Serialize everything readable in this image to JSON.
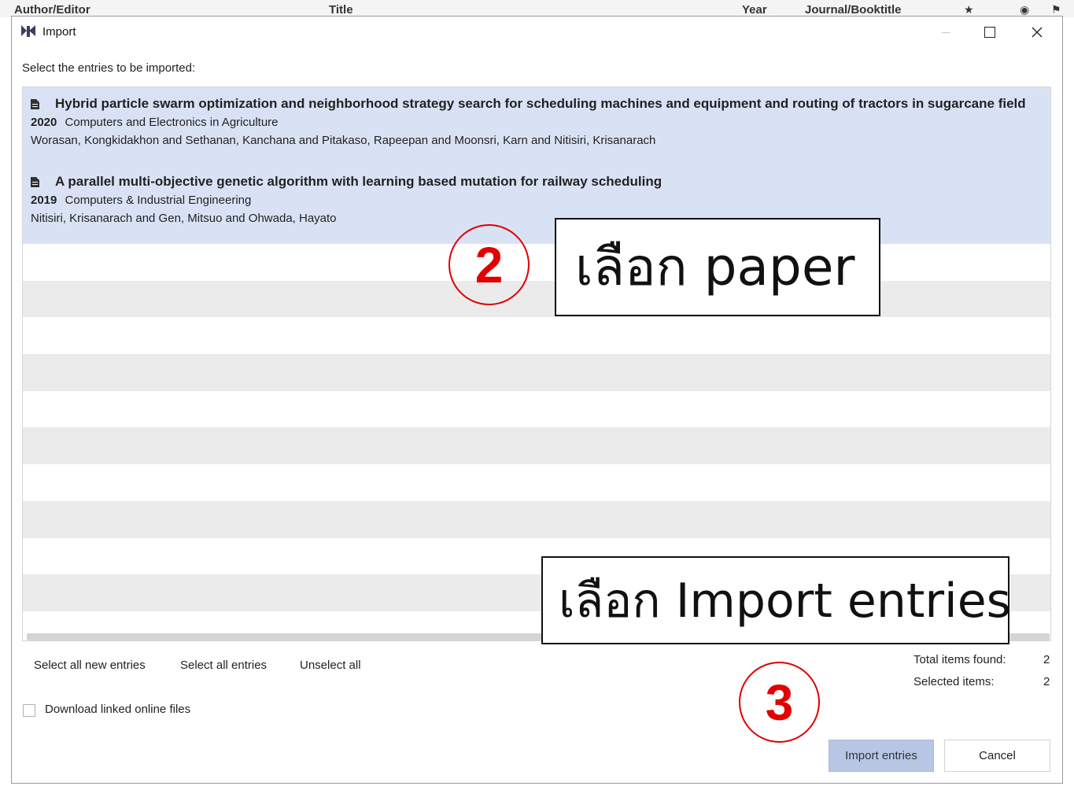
{
  "background_table": {
    "columns": {
      "author": "Author/Editor",
      "title": "Title",
      "year": "Year",
      "journal": "Journal/Booktitle",
      "star_icon": "★",
      "eye_icon": "◉",
      "flag_icon": "⚑"
    }
  },
  "window": {
    "title": "Import",
    "controls": {
      "minimize": "—",
      "close": "✕"
    }
  },
  "prompt": "Select the entries to be imported:",
  "entries": [
    {
      "title": "Hybrid particle swarm optimization and neighborhood strategy search for scheduling machines and equipment and routing of tractors in sugarcane field",
      "year": "2020",
      "journal": "Computers and Electronics in Agriculture",
      "authors": "Worasan, Kongkidakhon and Sethanan, Kanchana and Pitakaso, Rapeepan and Moonsri, Karn and Nitisiri, Krisanarach",
      "selected": true
    },
    {
      "title": "A parallel multi-objective genetic algorithm with learning based mutation for railway scheduling",
      "year": "2019",
      "journal": "Computers & Industrial Engineering",
      "authors": "Nitisiri, Krisanarach and Gen, Mitsuo and Ohwada, Hayato",
      "selected": true
    }
  ],
  "annotations": {
    "step2_number": "2",
    "step2_text": "เลือก paper",
    "step3_number": "3",
    "step3_text": "เลือก Import entries",
    "accent_color": "#e00000"
  },
  "selection_buttons": {
    "select_new": "Select all new entries",
    "select_all": "Select all entries",
    "unselect_all": "Unselect all"
  },
  "stats": {
    "total_label": "Total items found:",
    "total_value": "2",
    "selected_label": "Selected items:",
    "selected_value": "2"
  },
  "options": {
    "download_label": "Download linked online files",
    "download_checked": false
  },
  "actions": {
    "import_label": "Import entries",
    "cancel_label": "Cancel"
  },
  "colors": {
    "selection_highlight": "#d9e2f5",
    "import_button": "#b8c6e6"
  }
}
